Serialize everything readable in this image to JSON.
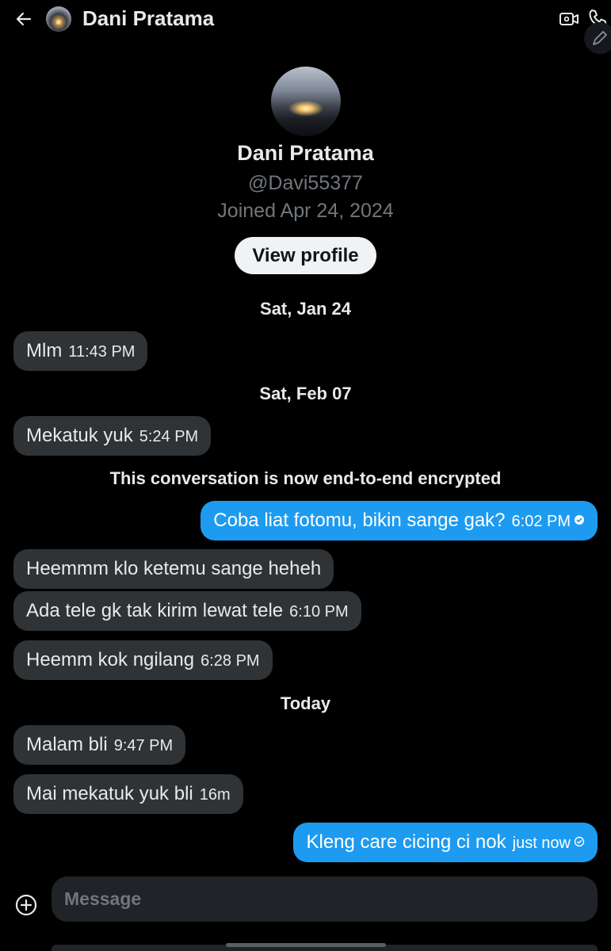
{
  "header": {
    "title": "Dani Pratama",
    "back_icon": "arrow-left-icon",
    "video_icon": "video-call-icon",
    "phone_icon": "phone-call-icon",
    "compose_icon": "pencil-icon"
  },
  "profile": {
    "name": "Dani Pratama",
    "handle": "@Davi55377",
    "joined": "Joined Apr 24, 2024",
    "view_profile_label": "View profile"
  },
  "messages": [
    {
      "type": "date",
      "text": "Sat, Jan 24"
    },
    {
      "type": "received",
      "text": "Mlm",
      "time": "11:43 PM"
    },
    {
      "type": "date",
      "text": "Sat, Feb 07"
    },
    {
      "type": "received",
      "text": "Mekatuk yuk",
      "time": "5:24 PM"
    },
    {
      "type": "notice",
      "text": "This conversation is now end-to-end encrypted"
    },
    {
      "type": "sent",
      "text": "Coba liat fotomu, bikin sange gak?",
      "time": "6:02 PM",
      "status": "seen"
    },
    {
      "type": "received",
      "text": "Heemmm klo ketemu sange heheh",
      "time": ""
    },
    {
      "type": "received",
      "text": "Ada tele gk tak kirim lewat tele",
      "time": "6:10 PM"
    },
    {
      "type": "received",
      "text": "Heemm kok ngilang",
      "time": "6:28 PM"
    },
    {
      "type": "date",
      "text": "Today"
    },
    {
      "type": "received",
      "text": "Malam bli",
      "time": "9:47 PM"
    },
    {
      "type": "received",
      "text": "Mai mekatuk yuk bli",
      "time": "16m"
    },
    {
      "type": "sent",
      "text": "Kleng care cicing ci nok",
      "time": "just now",
      "status": "sent"
    }
  ],
  "composer": {
    "placeholder": "Message",
    "add_icon": "plus-circle-icon"
  },
  "colors": {
    "background": "#000000",
    "received_bubble": "#2f3336",
    "sent_bubble": "#1d9bf0",
    "muted_text": "#71767b"
  }
}
